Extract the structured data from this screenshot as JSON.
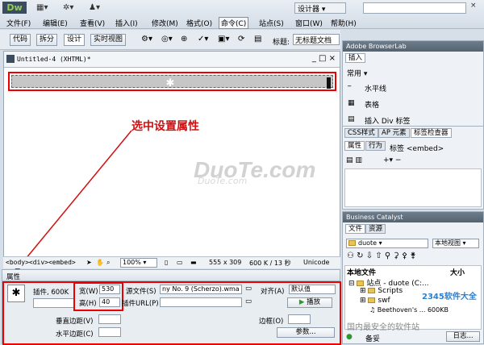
{
  "app": {
    "logo": "Dw",
    "designer_menu": "设计器",
    "search_placeholder": "",
    "menus": [
      "文件(F)",
      "编辑(E)",
      "查看(V)",
      "插入(I)",
      "修改(M)",
      "格式(O)",
      "命令(C)",
      "站点(S)",
      "窗口(W)",
      "帮助(H)"
    ]
  },
  "toolbar": {
    "buttons": [
      "代码",
      "拆分",
      "设计",
      "实时视图"
    ],
    "title_label": "标题:",
    "title_value": "无标题文档"
  },
  "document": {
    "tab_title": "Untitled-4 (XHTML)*",
    "controls": "_ □ ×"
  },
  "annotation": {
    "text": "选中设置属性"
  },
  "watermark": {
    "main": "DuoTe.com",
    "sub": "DuoTe.com"
  },
  "statusbar": {
    "tags": "<body><div><embed>",
    "zoom": "100%",
    "size": "555 x 309",
    "weight": "600 K / 13 秒",
    "encoding": "Unicode"
  },
  "properties": {
    "title": "属性",
    "plugin_label": "插件, 600K",
    "width_label": "宽(W)",
    "width_value": "530",
    "height_label": "高(H)",
    "height_value": "40",
    "src_label": "源文件(S)",
    "src_value": "ny No. 9 (Scherzo).wma",
    "pluginurl_label": "插件URL(P)",
    "pluginurl_value": "",
    "align_label": "对齐(A)",
    "align_value": "默认值",
    "play_label": "播放",
    "vspace_label": "垂直边距(V)",
    "hspace_label": "水平边距(C)",
    "border_label": "边框(O)",
    "params_label": "参数..."
  },
  "panels": {
    "browserlab": "Adobe BrowserLab",
    "insert_tab": "插入",
    "insert_category": "常用",
    "insert_items": [
      "水平线",
      "表格",
      "插入 Div 标签"
    ],
    "css_tabs": [
      "CSS样式",
      "AP 元素",
      "标签检查器"
    ],
    "tag_tabs": [
      "属性",
      "行为"
    ],
    "tag_label": "标签 <embed>",
    "business_catalyst": "Business Catalyst",
    "files_tabs": [
      "文件",
      "资源"
    ],
    "site_select": "duote",
    "view_select": "本地视图",
    "file_col_local": "本地文件",
    "file_col_size": "大小",
    "file_items": [
      "站点 - duote (C:...",
      "Scripts",
      "swf",
      "Beethoven's ...  600KB"
    ],
    "status_ready": "备妥",
    "log_button": "日志...",
    "logo_watermark": "2345软件大全",
    "logo_tagline": "国内最安全的软件站"
  },
  "colors": {
    "highlight": "#e00000",
    "annotation": "#d01010"
  }
}
